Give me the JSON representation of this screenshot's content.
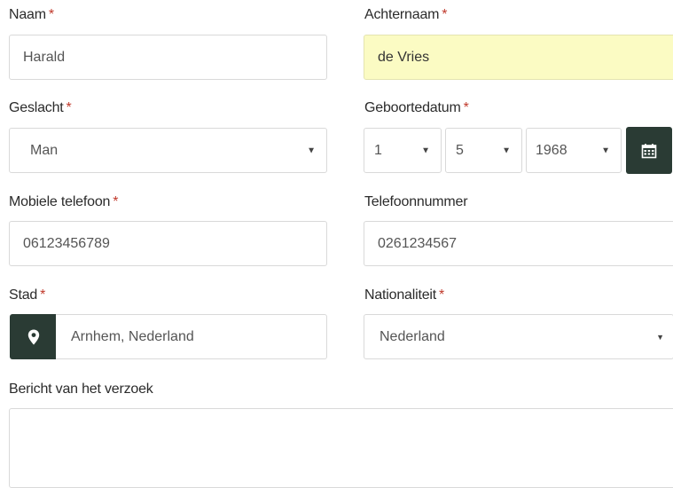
{
  "fields": {
    "naam": {
      "label": "Naam",
      "required": "*",
      "value": "Harald"
    },
    "achternaam": {
      "label": "Achternaam",
      "required": "*",
      "value": "de Vries"
    },
    "geslacht": {
      "label": "Geslacht",
      "required": "*",
      "value": "Man"
    },
    "geboortedatum": {
      "label": "Geboortedatum",
      "required": "*",
      "day": "1",
      "month": "5",
      "year": "1968"
    },
    "mobiel": {
      "label": "Mobiele telefoon",
      "required": "*",
      "value": "06123456789"
    },
    "telefoon": {
      "label": "Telefoonnummer",
      "value": "0261234567"
    },
    "stad": {
      "label": "Stad",
      "required": "*",
      "value": "Arnhem, Nederland"
    },
    "nationaliteit": {
      "label": "Nationaliteit",
      "required": "*",
      "value": "Nederland"
    },
    "bericht": {
      "label": "Bericht van het verzoek",
      "value": ""
    }
  },
  "icons": {
    "calendar": "calendar-icon",
    "location": "map-marker-icon"
  },
  "colors": {
    "accent_dark": "#2a3b34",
    "required": "#c0392b",
    "highlight": "#fbfbc3"
  }
}
